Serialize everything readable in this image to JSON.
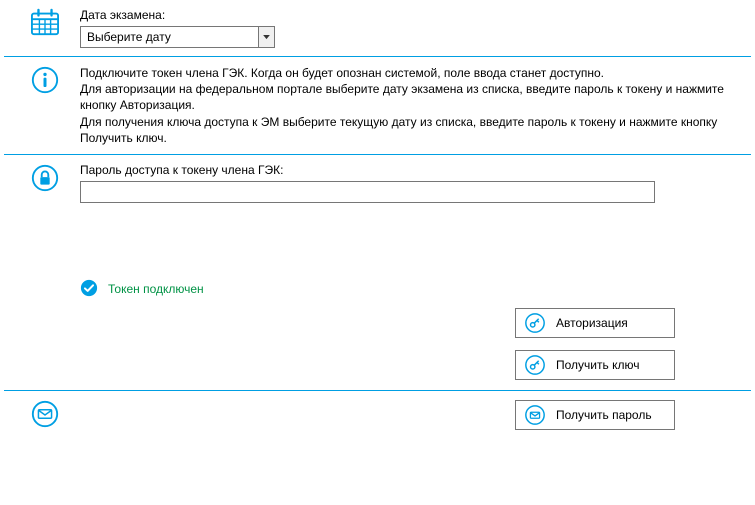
{
  "date_section": {
    "label": "Дата экзамена:",
    "select_placeholder": "Выберите дату"
  },
  "info": {
    "line1": "Подключите токен члена ГЭК. Когда он будет опознан системой, поле ввода станет доступно.",
    "line2": "Для авторизации на федеральном портале выберите дату экзамена из списка, введите пароль к токену и нажмите кнопку Авторизация.",
    "line3": "Для получения ключа доступа к ЭМ выберите текущую дату из списка, введите пароль к токену и нажмите кнопку Получить ключ."
  },
  "password": {
    "label": "Пароль доступа к токену члена ГЭК:",
    "value": ""
  },
  "status": {
    "text": "Токен подключен"
  },
  "buttons": {
    "auth": "Авторизация",
    "get_key": "Получить ключ",
    "get_password": "Получить пароль"
  },
  "colors": {
    "accent": "#009fe3",
    "success": "#009245"
  }
}
